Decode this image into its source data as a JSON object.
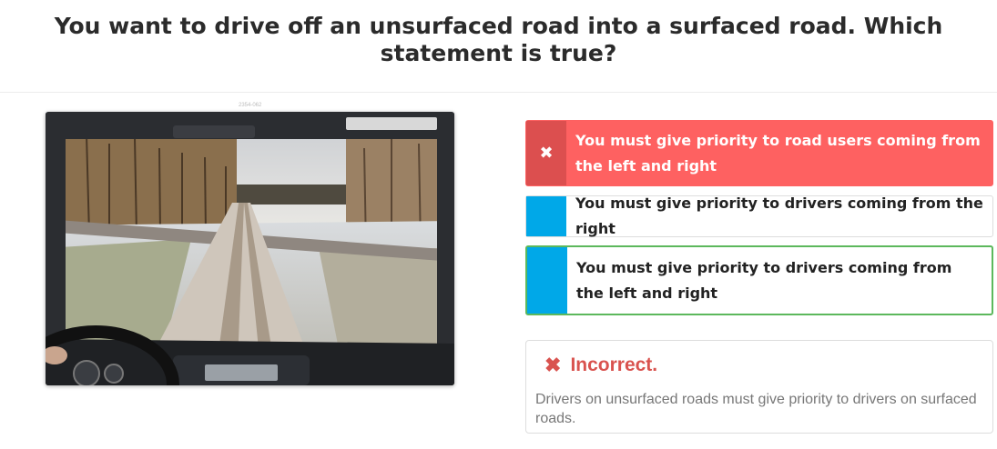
{
  "question": {
    "text": "You want to drive off an unsurfaced road into a surfaced road. Which statement is true?"
  },
  "photo": {
    "id_label": "2354-062",
    "description_icon": "dashcam-photo-icon"
  },
  "answers": [
    {
      "text": "You must give priority to road users coming from the left and right",
      "state": "selected-incorrect",
      "marker": "✖",
      "color": "#fe6161"
    },
    {
      "text": "You must give priority to drivers coming from the right",
      "state": "unselected",
      "color": "#00a8e8"
    },
    {
      "text": "You must give priority to drivers coming from the left and right",
      "state": "correct-highlight",
      "color": "#5cb85c"
    }
  ],
  "feedback": {
    "icon": "✖",
    "title": "Incorrect.",
    "explanation": "Drivers on unsurfaced roads must give priority to drivers on surfaced roads.",
    "color": "#d9534f"
  }
}
